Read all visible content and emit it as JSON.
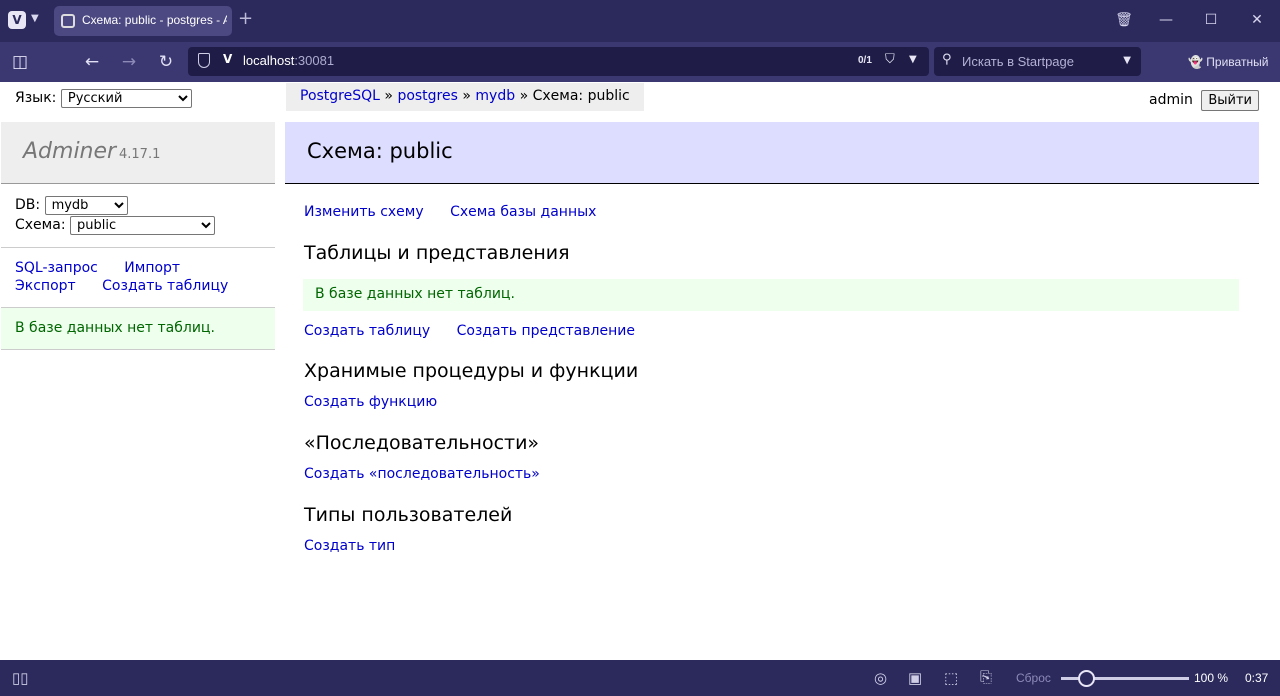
{
  "browser": {
    "tab_title": "Схема: public - postgres - Adminer",
    "new_tab": "+",
    "url_host": "localhost",
    "url_port": ":30081",
    "find_count": "0/1",
    "search_placeholder": "Искать в Startpage",
    "private_label": "Приватный",
    "status": {
      "reset_label": "Сброс",
      "zoom": "100 %",
      "zoom_level_percent": 100,
      "clock": "0:37"
    }
  },
  "sidebar": {
    "language_label": "Язык:",
    "language_value": "Русский",
    "app_name": "Adminer",
    "app_version": "4.17.1",
    "db_label": "DB:",
    "db_value": "mydb",
    "schema_label": "Схема:",
    "schema_value": "public",
    "links": [
      "SQL-запрос",
      "Импорт",
      "Экспорт",
      "Создать таблицу"
    ],
    "no_tables_msg": "В базе данных нет таблиц."
  },
  "breadcrumb": {
    "items": [
      "PostgreSQL",
      "postgres",
      "mydb"
    ],
    "separator": "»",
    "current": "Схема: public"
  },
  "user": {
    "name": "admin",
    "logout_label": "Выйти"
  },
  "main": {
    "title": "Схема: public",
    "top_links": [
      "Изменить схему",
      "Схема базы данных"
    ],
    "tables_heading": "Таблицы и представления",
    "tables_msg": "В базе данных нет таблиц.",
    "tables_links": [
      "Создать таблицу",
      "Создать представление"
    ],
    "routines_heading": "Хранимые процедуры и функции",
    "routines_link": "Создать функцию",
    "sequences_heading": "«Последовательности»",
    "sequences_link": "Создать «последовательность»",
    "types_heading": "Типы пользователей",
    "types_link": "Создать тип"
  },
  "colors": {
    "chrome": "#2c2a5c",
    "link": "#0000cc",
    "header_bg": "#ddddff",
    "message_bg": "#eeffee",
    "message_text": "#006600"
  }
}
